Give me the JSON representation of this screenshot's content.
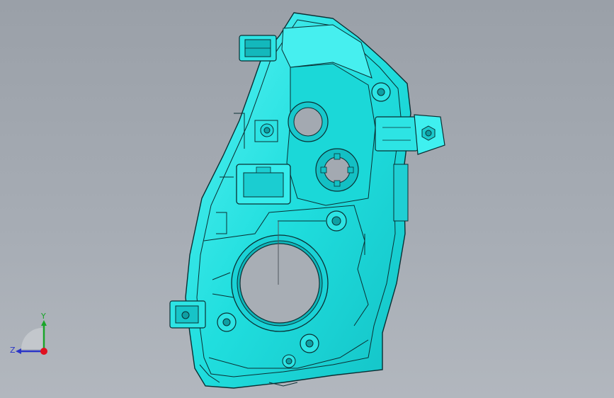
{
  "viewport": {
    "background_top": "#9aa0a8",
    "background_bottom": "#b2b7be",
    "model_color": "#2fe6e6",
    "model_edge_color": "#0a2f33"
  },
  "triad": {
    "y_label": "Y",
    "z_label": "Z",
    "y_color": "#1aa52a",
    "z_color": "#2a35c8",
    "origin_color": "#e01020"
  }
}
